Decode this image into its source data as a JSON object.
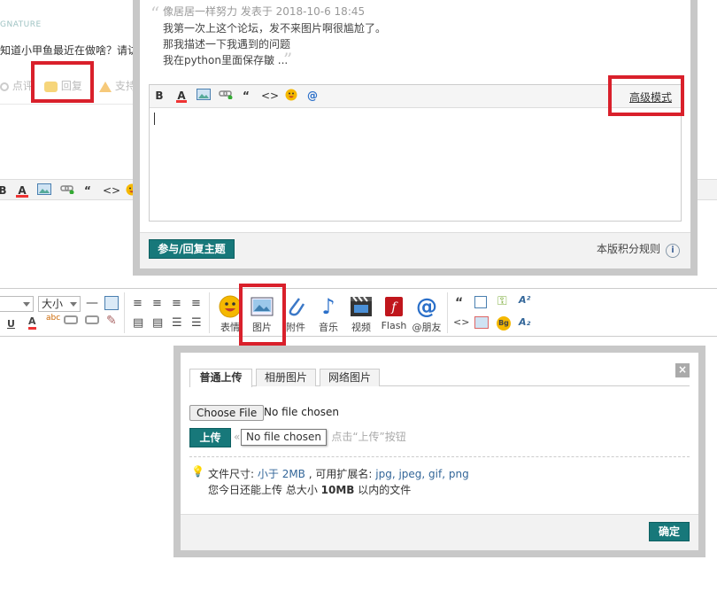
{
  "background": {
    "signature_label": "GNATURE",
    "post_text": "知道小甲鱼最近在做啥？请访",
    "actions": {
      "rate": "点评",
      "reply": "回复",
      "support": "支持"
    }
  },
  "reply_dialog": {
    "quote_author_line": "像居居一样努力 发表于 2018-10-6 18:45",
    "quote_lines": [
      "我第一次上这个论坛，发不来图片啊很尴尬了。",
      "那我描述一下我遇到的问题",
      "我在python里面保存皺 ..."
    ],
    "toolbar": {
      "bold": "B",
      "font_color": "A",
      "quote": "“",
      "code": "<>",
      "at": "@"
    },
    "advanced_mode_link": "高级模式",
    "submit_button": "参与/回复主题",
    "rules_link": "本版积分规则",
    "info_icon": "i"
  },
  "editor_toolbar": {
    "size_select": "大小",
    "font_select": "",
    "buttons": [
      {
        "label": "表情",
        "icon": "emoji-icon"
      },
      {
        "label": "图片",
        "icon": "image-icon"
      },
      {
        "label": "附件",
        "icon": "paperclip-icon"
      },
      {
        "label": "音乐",
        "icon": "music-icon"
      },
      {
        "label": "视频",
        "icon": "video-icon"
      },
      {
        "label": "Flash",
        "icon": "flash-icon"
      },
      {
        "label": "@朋友",
        "icon": "at-icon"
      }
    ],
    "small_glyphs": {
      "underline": "U",
      "color_a": "A",
      "bg": "Bg",
      "sup": "A²",
      "sub": "A₂",
      "quote": "“",
      "code": "<>"
    }
  },
  "upload_dialog": {
    "tabs": [
      "普通上传",
      "相册图片",
      "网络图片"
    ],
    "active_tab": "普通上传",
    "close": "×",
    "choose_file_button": "Choose File",
    "no_file_text": "No file chosen",
    "upload_button": "上传",
    "hint_text": "点击“上传”按钮",
    "tooltip": "No file chosen",
    "file_size_label": "文件尺寸:",
    "file_size_value": "小于 2MB",
    "ext_label": ", 可用扩展名:",
    "ext_value": "jpg, jpeg, gif, png",
    "quota_prefix": "您今日还能上传 总大小",
    "quota_value": "10MB",
    "quota_suffix": "以内的文件",
    "confirm_button": "确定"
  },
  "colors": {
    "teal": "#17787a",
    "highlight_red": "#d9202b",
    "dialog_border": "#c8c8c8"
  }
}
